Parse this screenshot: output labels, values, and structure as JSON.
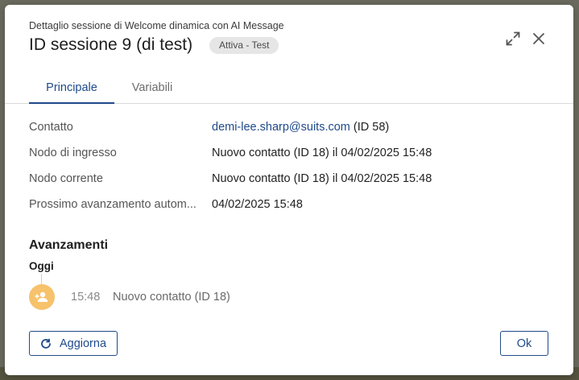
{
  "dialog": {
    "subtitle": "Dettaglio sessione di Welcome dinamica con AI Message",
    "title": "ID sessione 9 (di test)",
    "status_badge": "Attiva - Test"
  },
  "tabs": [
    {
      "label": "Principale",
      "active": true
    },
    {
      "label": "Variabili",
      "active": false
    }
  ],
  "details": {
    "contact": {
      "label": "Contatto",
      "email": "demi-lee.sharp@suits.com",
      "id_suffix": "(ID 58)"
    },
    "entry_node": {
      "label": "Nodo di ingresso",
      "value": "Nuovo contatto (ID 18) il 04/02/2025 15:48"
    },
    "current_node": {
      "label": "Nodo corrente",
      "value": "Nuovo contatto (ID 18) il 04/02/2025 15:48"
    },
    "next_auto": {
      "label": "Prossimo avanzamento autom...",
      "value": "04/02/2025 15:48"
    }
  },
  "progress": {
    "title": "Avanzamenti",
    "day": "Oggi",
    "events": [
      {
        "time": "15:48",
        "text": "Nuovo contatto (ID 18)",
        "icon": "person-add-icon"
      }
    ]
  },
  "footer": {
    "refresh_label": "Aggiorna",
    "ok_label": "Ok"
  },
  "colors": {
    "accent": "#1f4a8a",
    "avatar_bg": "#f6c26b",
    "badge_bg": "#e6e6e6"
  }
}
